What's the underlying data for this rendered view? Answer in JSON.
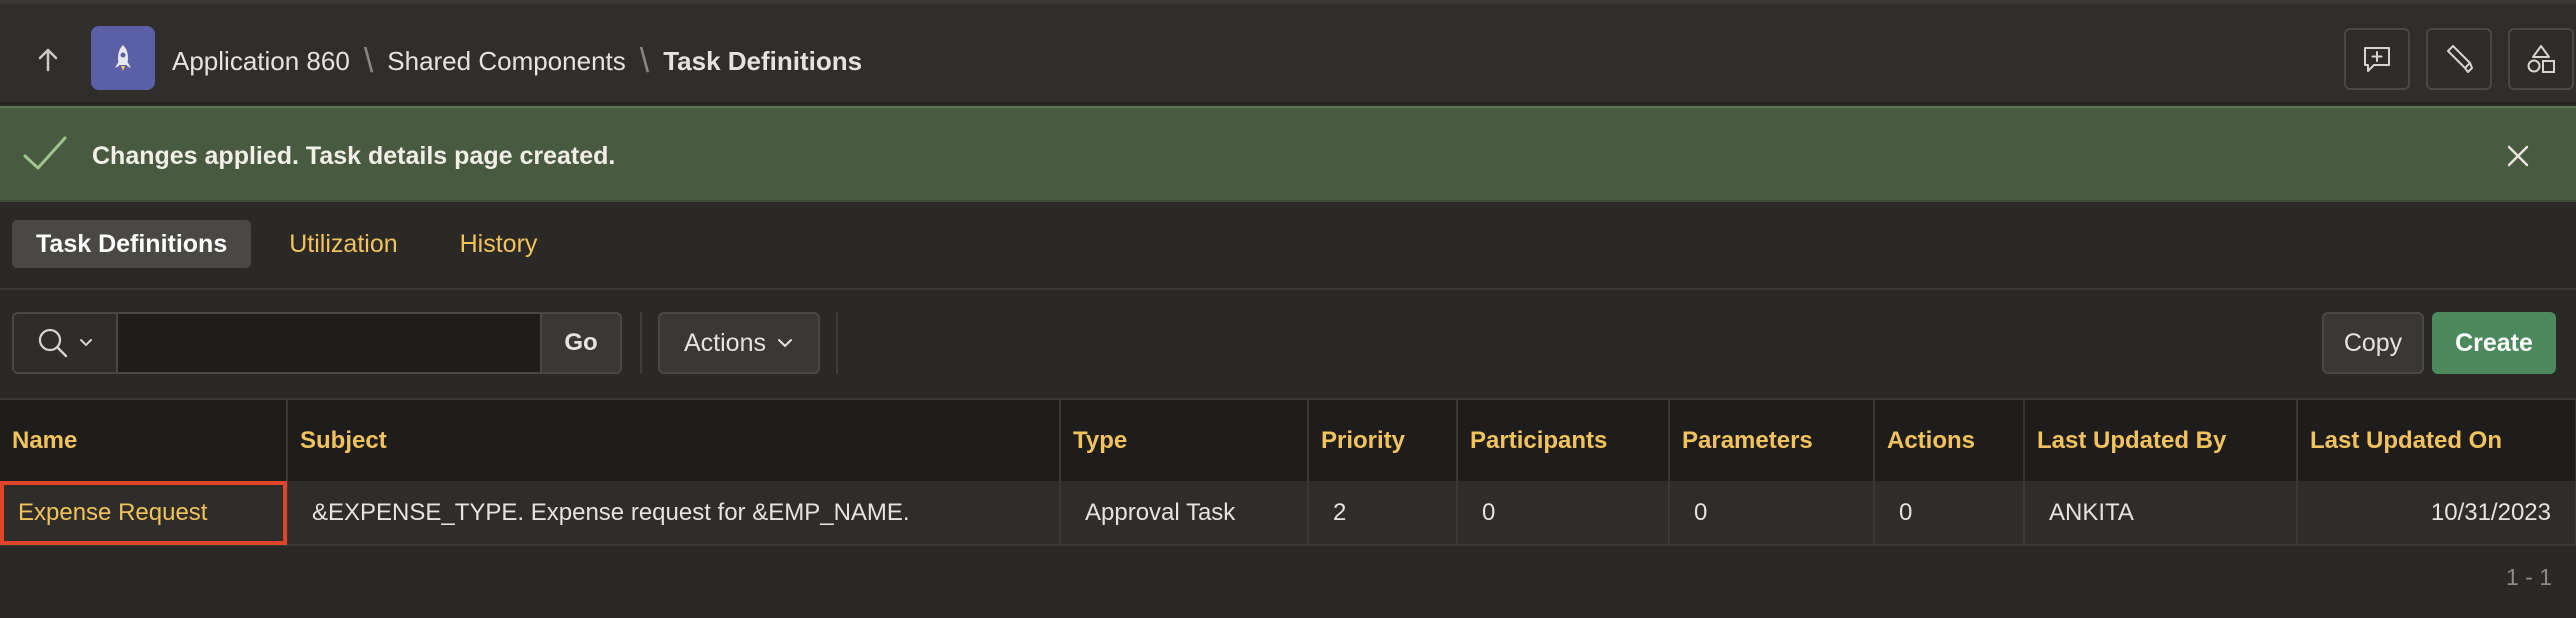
{
  "header": {
    "breadcrumb": [
      {
        "label": "Application 860"
      },
      {
        "label": "Shared Components"
      },
      {
        "label": "Task Definitions"
      }
    ],
    "toolbar_icons": [
      "add-comment-icon",
      "developer-tools-icon",
      "shared-components-icon"
    ]
  },
  "alert": {
    "message": "Changes applied. Task details page created."
  },
  "tabs": [
    {
      "label": "Task Definitions",
      "active": true
    },
    {
      "label": "Utilization",
      "active": false
    },
    {
      "label": "History",
      "active": false
    }
  ],
  "toolbar": {
    "search_value": "",
    "go_label": "Go",
    "actions_label": "Actions",
    "copy_label": "Copy",
    "create_label": "Create"
  },
  "table": {
    "columns": [
      "Name",
      "Subject",
      "Type",
      "Priority",
      "Participants",
      "Parameters",
      "Actions",
      "Last Updated By",
      "Last Updated On"
    ],
    "rows": [
      {
        "name": "Expense Request",
        "subject": "&EXPENSE_TYPE. Expense request for &EMP_NAME.",
        "type": "Approval Task",
        "priority": "2",
        "participants": "0",
        "parameters": "0",
        "actions": "0",
        "last_updated_by": "ANKITA",
        "last_updated_on": "10/31/2023"
      }
    ]
  },
  "pagination": "1 - 1",
  "colors": {
    "accent": "#f2c25c",
    "success_bg": "#485b40",
    "create_button": "#4c8a5e",
    "highlight": "#e0452b"
  }
}
